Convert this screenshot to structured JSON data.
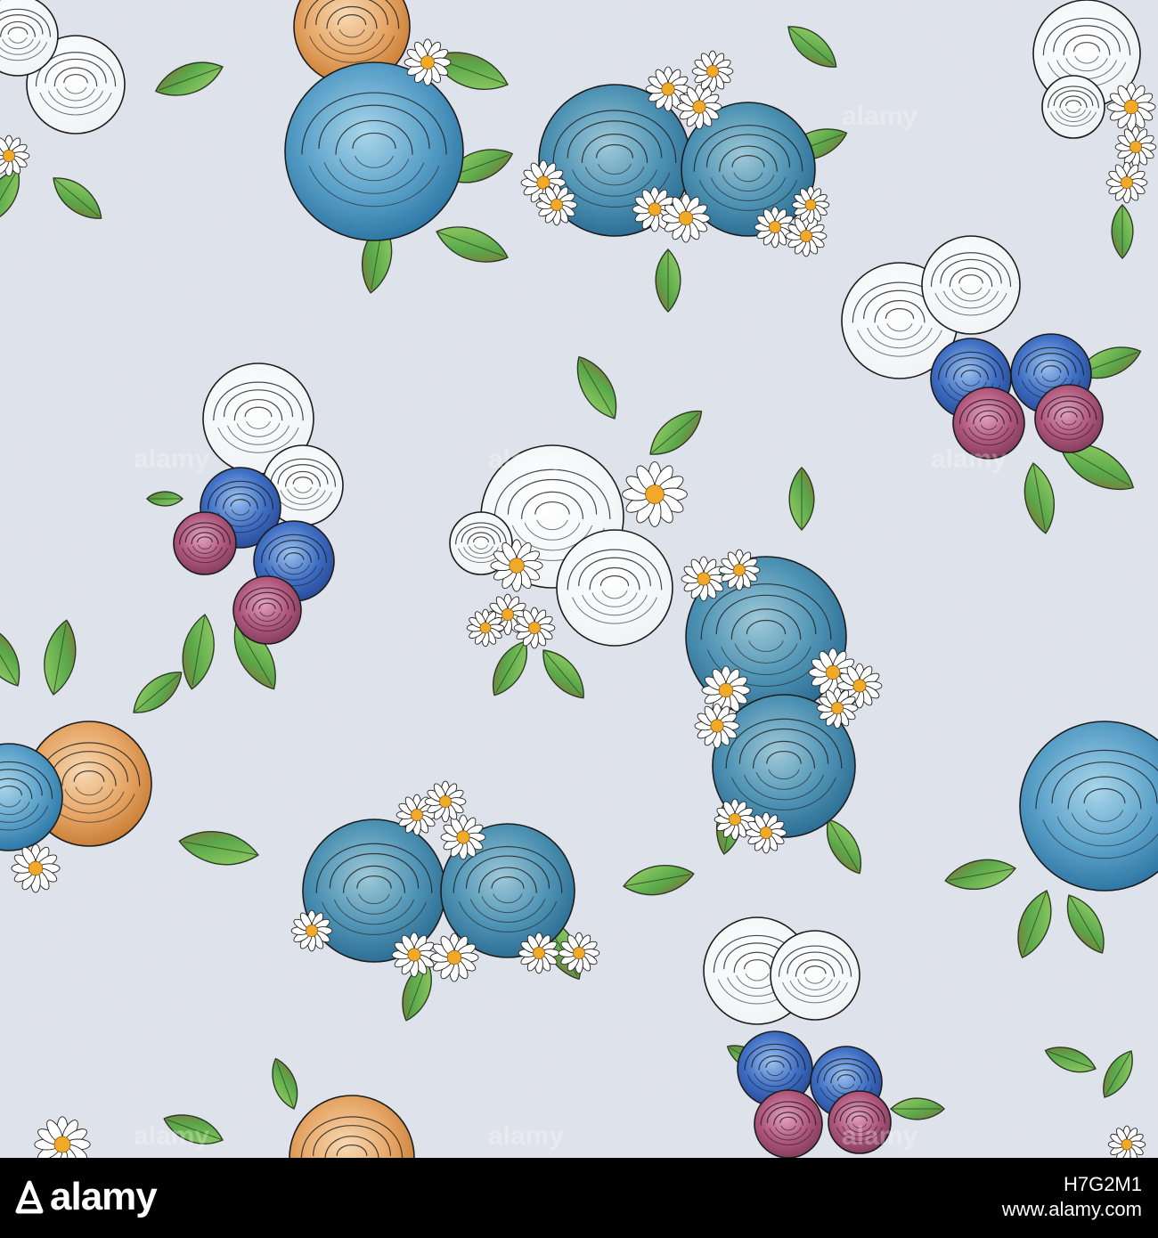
{
  "image": {
    "subject": "floral-pattern",
    "background_color": "#dde1ea",
    "watermark_text": "alamy",
    "colors": {
      "blue_rose": "#5aa0c8",
      "deep_blue_rose": "#3f6fc4",
      "orange_rose": "#e6a666",
      "pink_rose": "#b0577c",
      "leaf": "#5aa84a",
      "daisy_center": "#f0a928"
    }
  },
  "footer": {
    "brand": "alamy",
    "image_id": "H7G2M1",
    "site": "www.alamy.com",
    "background": "#000000",
    "text_color": "#ffffff"
  }
}
